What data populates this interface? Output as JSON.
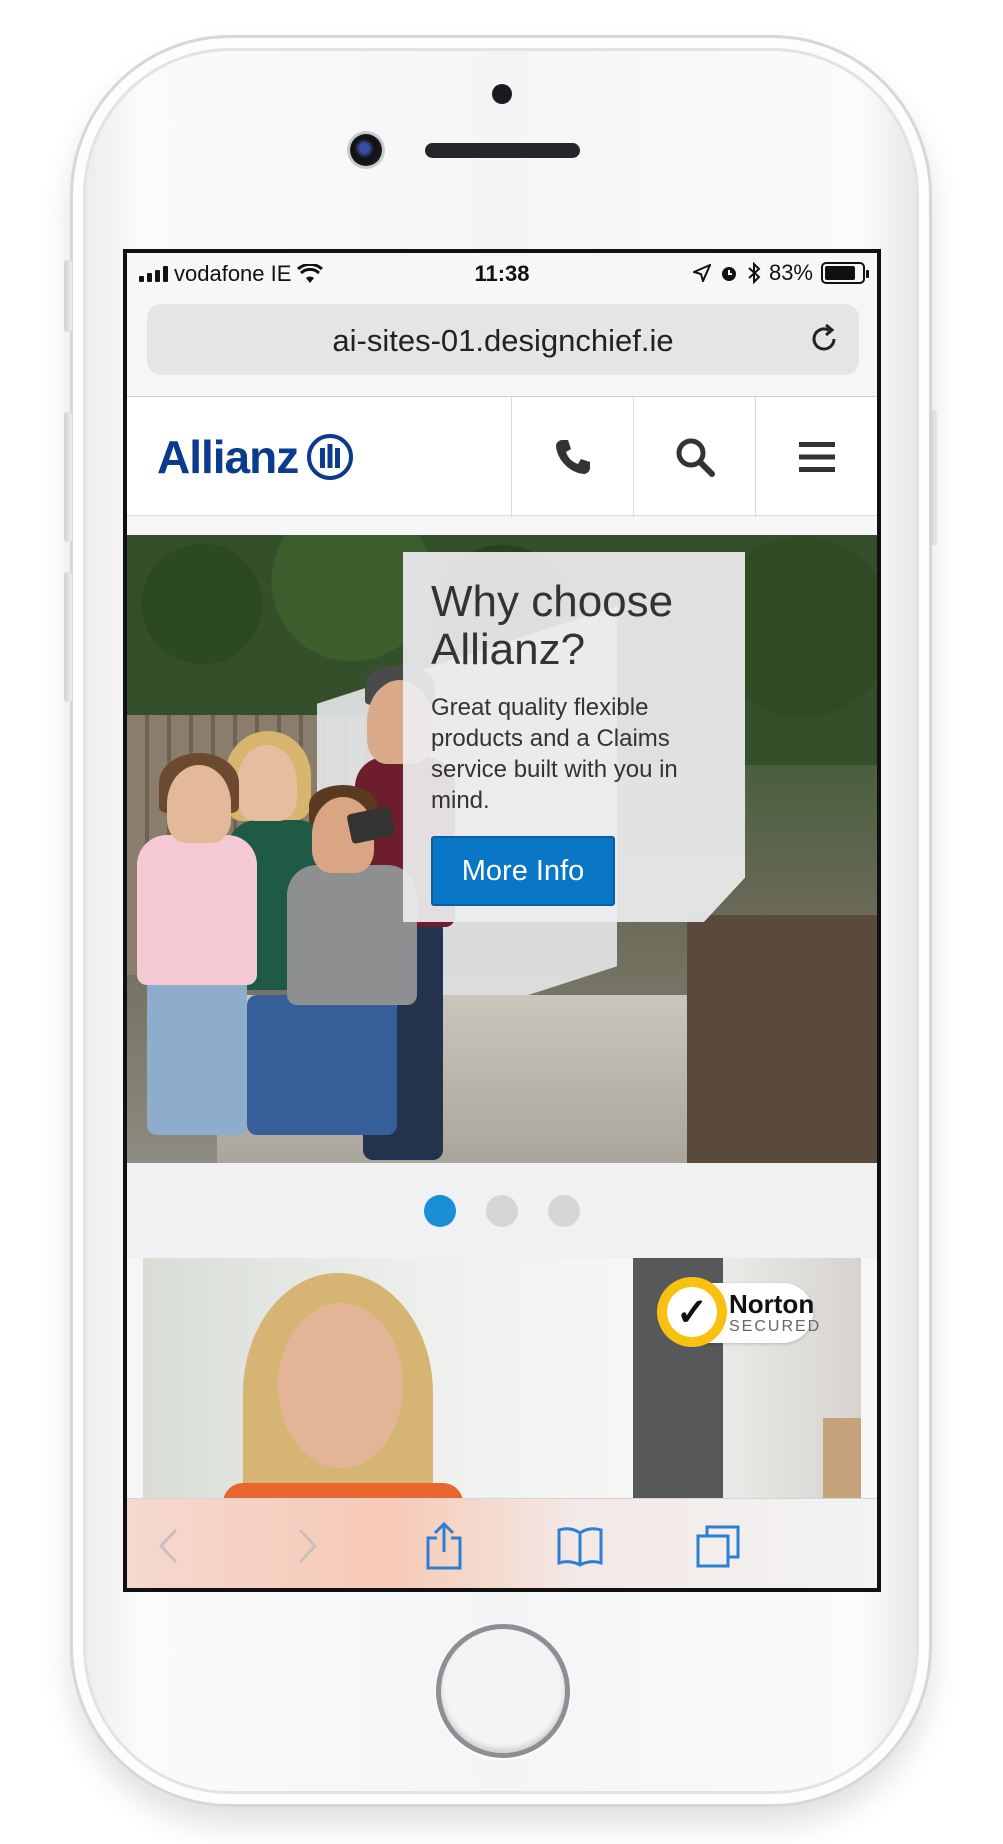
{
  "status_bar": {
    "carrier": "vodafone IE",
    "time": "11:38",
    "battery": "83%",
    "battery_level": 0.83
  },
  "browser": {
    "url": "ai-sites-01.designchief.ie",
    "icons": [
      "reload-icon",
      "back-icon",
      "forward-icon",
      "share-icon",
      "bookmarks-icon",
      "tabs-icon"
    ]
  },
  "header": {
    "logo_text": "Allianz",
    "icons": [
      "phone-icon",
      "search-icon",
      "menu-icon"
    ]
  },
  "hero": {
    "title": "Why choose Allianz?",
    "text": "Great quality flexible products and a Claims service built with you in mind.",
    "button_label": "More Info"
  },
  "carousel": {
    "count": 3,
    "active_index": 0
  },
  "promo": {
    "badge_name": "Norton",
    "badge_sub": "SECURED"
  },
  "colors": {
    "brand": "#0b3b8c",
    "button": "#0a76c6",
    "dot_active": "#1a8fd6",
    "dot_inactive": "#d3d5d7",
    "toolbar_icon": "#2b7fd4"
  }
}
